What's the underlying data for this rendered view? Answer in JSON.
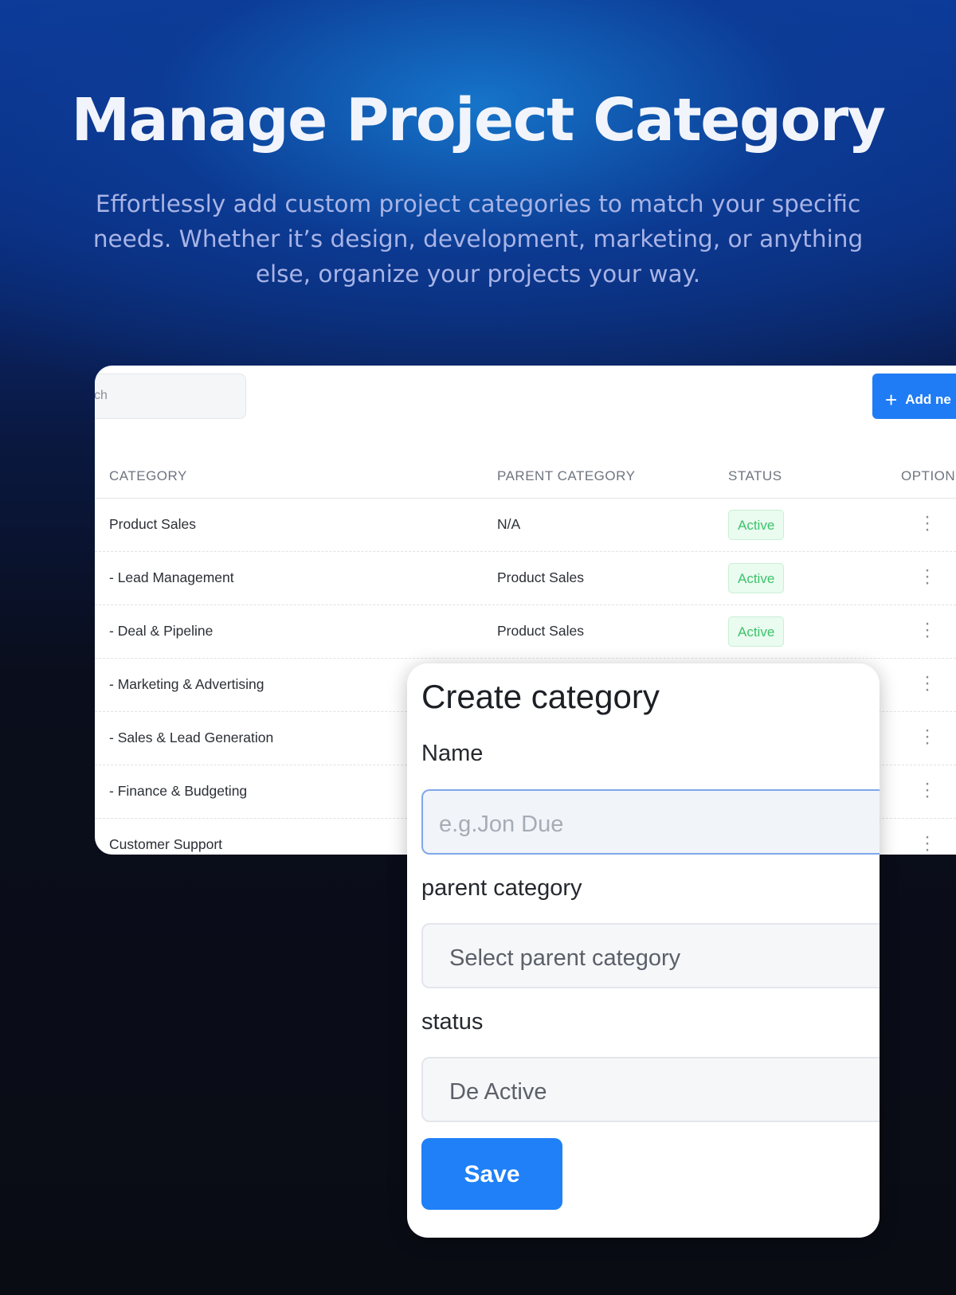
{
  "hero": {
    "title": "Manage Project Category",
    "subtitle": "Effortlessly add custom project categories to match your specific needs. Whether it’s design, development, marketing, or anything else, organize your projects your way."
  },
  "toolbar": {
    "search_text": "ch",
    "add_button_label": "Add ne"
  },
  "table": {
    "columns": [
      "CATEGORY",
      "PARENT CATEGORY",
      "STATUS",
      "OPTION"
    ],
    "rows": [
      {
        "category": "Product Sales",
        "parent": "N/A",
        "status": "Active"
      },
      {
        "category": "- Lead Management",
        "parent": "Product Sales",
        "status": "Active"
      },
      {
        "category": "- Deal & Pipeline",
        "parent": "Product Sales",
        "status": "Active"
      },
      {
        "category": "- Marketing & Advertising",
        "parent": "",
        "status": ""
      },
      {
        "category": "- Sales & Lead Generation",
        "parent": "",
        "status": ""
      },
      {
        "category": "- Finance & Budgeting",
        "parent": "",
        "status": ""
      },
      {
        "category": "Customer Support",
        "parent": "",
        "status": ""
      }
    ]
  },
  "modal": {
    "title": "Create category",
    "name_label": "Name",
    "name_placeholder": "e.g.Jon Due",
    "parent_label": "parent category",
    "parent_value": "Select parent category",
    "status_label": "status",
    "status_value": "De Active",
    "save_label": "Save"
  },
  "colors": {
    "accent": "#1f80f8",
    "status_active": "#3cc36a"
  }
}
